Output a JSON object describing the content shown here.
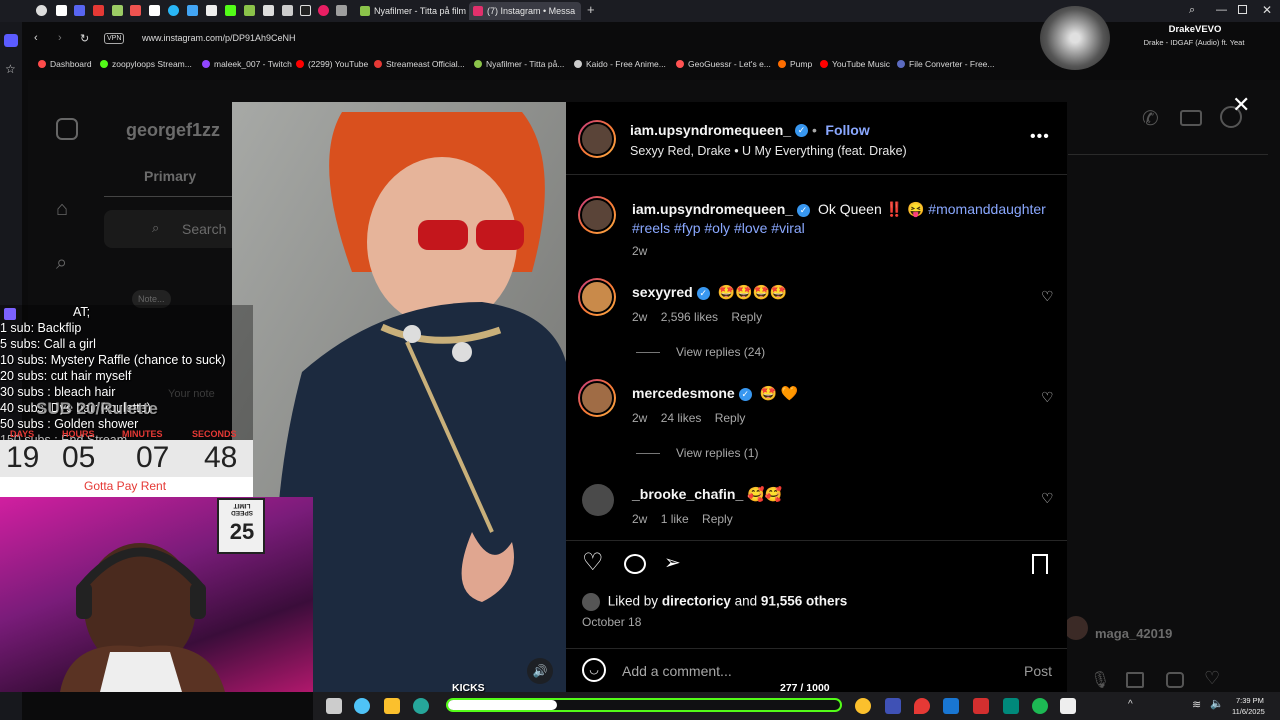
{
  "browser": {
    "tabs": [
      {
        "label": "Nyafilmer - Titta på filmer",
        "icon_color": "#8bc34a"
      },
      {
        "label": "(7) Instagram • Messa",
        "icon_color": "#e1306c"
      }
    ],
    "address": "www.instagram.com/p/DP91Ah9CeNH",
    "vpn_label": "VPN",
    "bookmarks": [
      {
        "label": "Dashboard",
        "color": "#ff4b4b"
      },
      {
        "label": "zoopyloops Stream...",
        "color": "#53fc18"
      },
      {
        "label": "maleek_007 - Twitch",
        "color": "#9146ff"
      },
      {
        "label": "(2299) YouTube",
        "color": "#ff0000"
      },
      {
        "label": "Streameast Official...",
        "color": "#e53935"
      },
      {
        "label": "Nyafilmer - Titta på...",
        "color": "#8bc34a"
      },
      {
        "label": "Kaido - Free Anime...",
        "color": "#cccccc"
      },
      {
        "label": "GeoGuessr - Let's e...",
        "color": "#ff5252"
      },
      {
        "label": "Pump",
        "color": "#ff6d00"
      },
      {
        "label": "YouTube Music",
        "color": "#ff0000"
      },
      {
        "label": "File Converter - Free...",
        "color": "#5c6bc0"
      }
    ],
    "now_playing": {
      "artist": "DrakeVEVO",
      "track": "Drake - IDGAF (Audio) ft. Yeat"
    }
  },
  "instagram_bg": {
    "username": "georgef1zz",
    "tab_primary": "Primary",
    "search_placeholder": "Search",
    "note_label": "Note...",
    "your_note": "Your note",
    "right_user": "maga_42019"
  },
  "post": {
    "author": "iam.upsyndromequeen_",
    "follow_label": "Follow",
    "audio": "Sexyy Red, Drake • U My Everything (feat. Drake)",
    "caption_text": "Ok Queen ‼️ 😝",
    "caption_tags": "#momanddaughter",
    "caption_tags2": "#reels #fyp #oly #love #viral",
    "caption_time": "2w",
    "comments": [
      {
        "user": "sexyyred",
        "verified": true,
        "text": "🤩🤩🤩🤩",
        "time": "2w",
        "likes": "2,596 likes",
        "reply": "Reply",
        "view_replies": "View replies (24)"
      },
      {
        "user": "mercedesmone",
        "verified": true,
        "text": "🤩 🧡",
        "time": "2w",
        "likes": "24 likes",
        "reply": "Reply",
        "view_replies": "View replies (1)"
      },
      {
        "user": "_brooke_chafin_",
        "verified": false,
        "text": "🥰🥰",
        "time": "2w",
        "likes": "1 like",
        "reply": "Reply"
      }
    ],
    "liked_by_prefix": "Liked by",
    "liked_by_user": "directoricy",
    "liked_by_suffix": "and",
    "liked_count": "91,556 others",
    "date": "October 18",
    "comment_placeholder": "Add a comment...",
    "post_label": "Post"
  },
  "overlay": {
    "header": "AT;",
    "goals": [
      "1 sub: Backflip",
      "5 subs: Call a girl",
      "10 subs: Mystery Raffle (chance to suck)",
      "20 subs: cut hair myself",
      "30 subs : bleach hair",
      "40 subs: Dye hair (roulette)",
      "50 subs : Golden shower",
      "150 subs : End Stream"
    ],
    "big_text": "SUB 20/Rulette",
    "timer_labels": [
      "DAYS",
      "HOURS",
      "MINUTES",
      "SECONDS"
    ],
    "timer_values": [
      "19",
      "05",
      "07",
      "48"
    ],
    "rent_text": "Gotta Pay Rent",
    "speed_sign_text": "SPEED LIMIT",
    "speed_sign_value": "25"
  },
  "taskbar": {
    "kicks_label": "KICKS",
    "progress_text": "277 / 1000",
    "progress_value": 0.277,
    "time": "7:39 PM",
    "date": "11/6/2025"
  }
}
